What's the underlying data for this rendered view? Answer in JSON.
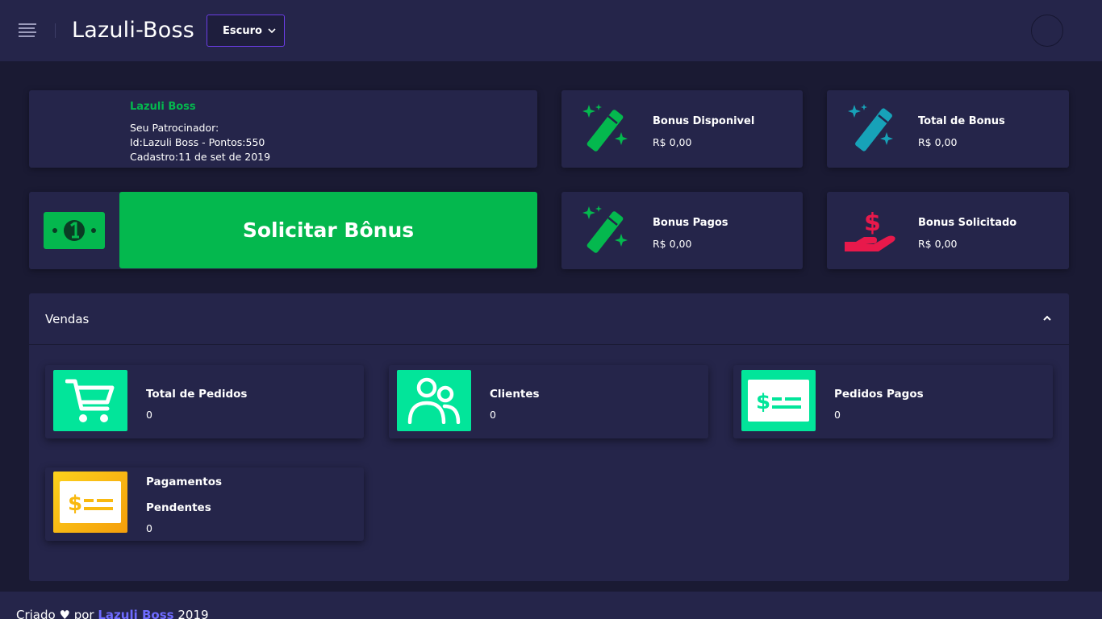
{
  "header": {
    "app_title": "Lazuli-Boss",
    "theme_select": {
      "value": "Escuro"
    },
    "icons": {
      "menu": "hamburger-menu-icon",
      "dropdown": "chevron-down-icon",
      "avatar": "avatar"
    }
  },
  "sponsor": {
    "name": "Lazuli Boss",
    "line1": "Seu Patrocinador:",
    "line2": "Id:Lazuli Boss - Pontos:550",
    "line3": "Cadastro:11 de set de 2019"
  },
  "stats": [
    {
      "label": "Bonus Disponivel",
      "value": "R$ 0,00",
      "icon": "magic-wand-icon",
      "color": "#04b84e"
    },
    {
      "label": "Total de Bonus",
      "value": "R$ 0,00",
      "icon": "magic-wand-icon",
      "color": "#17a2b8"
    },
    {
      "label": "Bonus Pagos",
      "value": "R$ 0,00",
      "icon": "magic-wand-icon",
      "color": "#04b84e"
    },
    {
      "label": "Bonus Solicitado",
      "value": "R$ 0,00",
      "icon": "hand-dollar-icon",
      "color": "#e8194b"
    }
  ],
  "solicitar": {
    "label": "Solicitar Bônus",
    "icon": "money-bill-icon",
    "color": "#04b84e"
  },
  "vendas": {
    "title": "Vendas",
    "cards": [
      {
        "label": "Total de Pedidos",
        "value": "0",
        "icon": "shopping-cart-icon",
        "color": "#02e59a"
      },
      {
        "label": "Clientes",
        "value": "0",
        "icon": "users-icon",
        "color": "#02e59a"
      },
      {
        "label": "Pedidos Pagos",
        "value": "0",
        "icon": "money-check-icon",
        "color": "#02e59a"
      },
      {
        "label_line1": "Pagamentos",
        "label_line2": "Pendentes",
        "value": "0",
        "icon": "money-check-icon",
        "color": "#f9b90f"
      }
    ]
  },
  "footer": {
    "prefix": "Criado",
    "heart": "♥",
    "by": "por",
    "link": "Lazuli Boss",
    "year": "2019"
  },
  "colors": {
    "background": "#1a1a33",
    "card": "#25254a",
    "green": "#04b84e",
    "accent_link": "#6e6bff"
  }
}
